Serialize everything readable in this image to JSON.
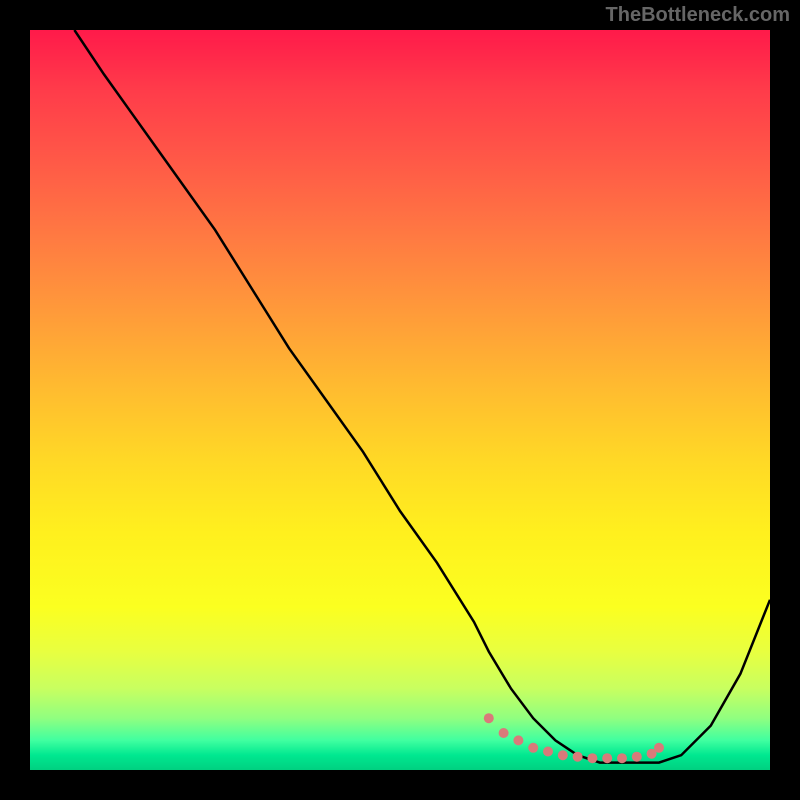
{
  "watermark": "TheBottleneck.com",
  "chart_data": {
    "type": "line",
    "title": "",
    "xlabel": "",
    "ylabel": "",
    "xlim": [
      0,
      100
    ],
    "ylim": [
      0,
      100
    ],
    "series": [
      {
        "name": "bottleneck-curve",
        "x": [
          6,
          10,
          15,
          20,
          25,
          30,
          35,
          40,
          45,
          50,
          55,
          60,
          62,
          65,
          68,
          71,
          74,
          77,
          80,
          82,
          85,
          88,
          92,
          96,
          100
        ],
        "values": [
          100,
          94,
          87,
          80,
          73,
          65,
          57,
          50,
          43,
          35,
          28,
          20,
          16,
          11,
          7,
          4,
          2,
          1,
          1,
          1,
          1,
          2,
          6,
          13,
          23
        ]
      }
    ],
    "markers": {
      "name": "highlight-dots",
      "color": "#d97a7a",
      "x": [
        62,
        64,
        66,
        68,
        70,
        72,
        74,
        76,
        78,
        80,
        82,
        84,
        85
      ],
      "values": [
        7,
        5,
        4,
        3,
        2.5,
        2,
        1.8,
        1.6,
        1.6,
        1.6,
        1.8,
        2.2,
        3
      ]
    },
    "gradient_stops": [
      {
        "pos": 0,
        "color": "#ff1a4a"
      },
      {
        "pos": 50,
        "color": "#ffd826"
      },
      {
        "pos": 85,
        "color": "#e8ff40"
      },
      {
        "pos": 100,
        "color": "#00d080"
      }
    ]
  }
}
